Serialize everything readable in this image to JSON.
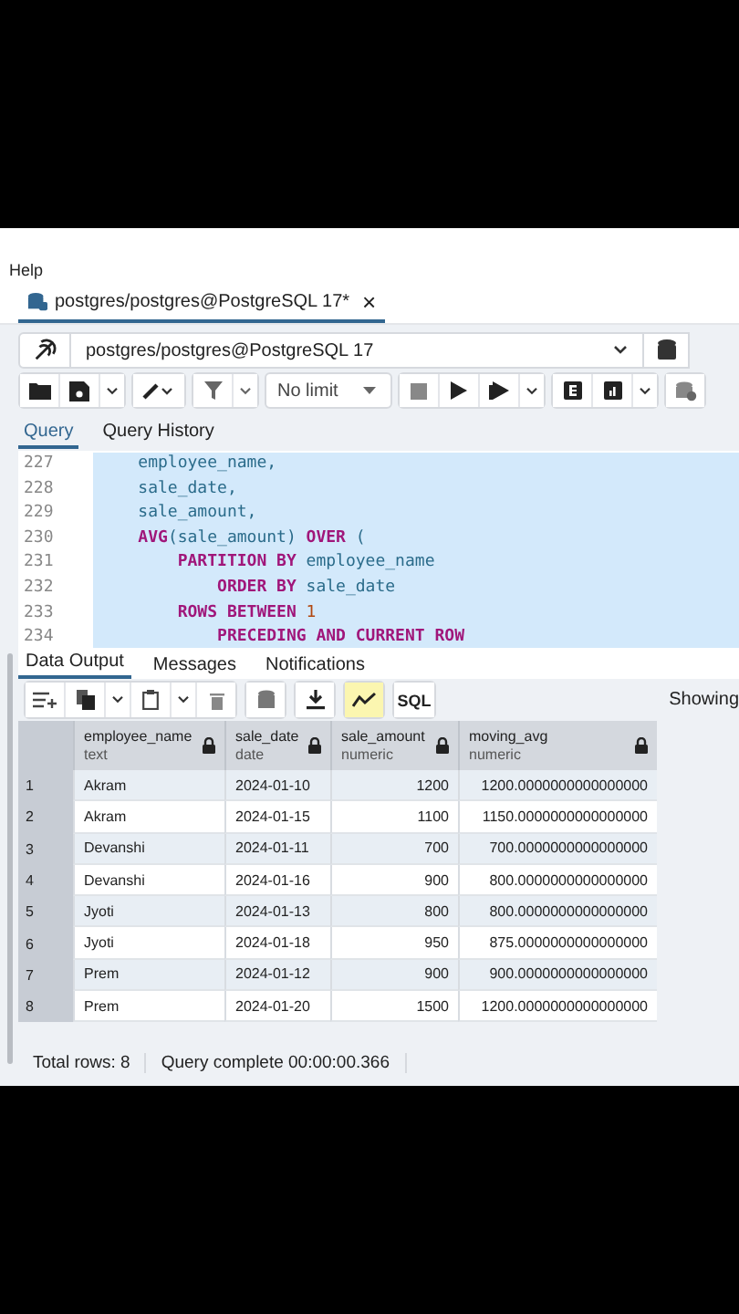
{
  "menu": {
    "item": "Help"
  },
  "query_tab": {
    "title": "postgres/postgres@PostgreSQL 17*",
    "close": "×"
  },
  "connection": {
    "value": "postgres/postgres@PostgreSQL 17"
  },
  "toolbar": {
    "limit": "No limit"
  },
  "editor_tabs": [
    {
      "label": "Query",
      "selected": true
    },
    {
      "label": "Query History",
      "selected": false
    }
  ],
  "code": [
    {
      "number": "227",
      "tokens": [
        {
          "kind": "plain",
          "text": "    employee_name,"
        }
      ]
    },
    {
      "number": "228",
      "tokens": [
        {
          "kind": "plain",
          "text": "    sale_date,"
        }
      ]
    },
    {
      "number": "229",
      "tokens": [
        {
          "kind": "plain",
          "text": "    sale_amount,"
        }
      ]
    },
    {
      "number": "230",
      "tokens": [
        {
          "kind": "keyword",
          "text": "    AVG"
        },
        {
          "kind": "plain",
          "text": "(sale_amount) "
        },
        {
          "kind": "keyword",
          "text": "OVER"
        },
        {
          "kind": "plain",
          "text": " ("
        }
      ]
    },
    {
      "number": "231",
      "tokens": [
        {
          "kind": "keyword",
          "text": "        PARTITION BY"
        },
        {
          "kind": "plain",
          "text": " employee_name"
        }
      ]
    },
    {
      "number": "232",
      "tokens": [
        {
          "kind": "keyword",
          "text": "            ORDER BY"
        },
        {
          "kind": "plain",
          "text": " sale_date"
        }
      ]
    },
    {
      "number": "233",
      "tokens": [
        {
          "kind": "keyword",
          "text": "        ROWS BETWEEN"
        },
        {
          "kind": "number",
          "text": " 1"
        }
      ]
    },
    {
      "number": "234",
      "tokens": [
        {
          "kind": "keyword",
          "text": "            PRECEDING AND CURRENT ROW"
        }
      ]
    }
  ],
  "output_tabs": [
    {
      "label": "Data Output",
      "selected": true
    },
    {
      "label": "Messages",
      "selected": false
    },
    {
      "label": "Notifications",
      "selected": false
    }
  ],
  "result_toolbar": {
    "sql_button": "SQL",
    "showing": "Showing"
  },
  "table": {
    "columns": [
      {
        "name": "employee_name",
        "type": "text",
        "kind": "text"
      },
      {
        "name": "sale_date",
        "type": "date",
        "kind": "text"
      },
      {
        "name": "sale_amount",
        "type": "numeric",
        "kind": "number"
      },
      {
        "name": "moving_avg",
        "type": "numeric",
        "kind": "number"
      }
    ],
    "rows": [
      {
        "number": "1",
        "cells": [
          "Akram",
          "2024-01-10",
          "1200",
          "1200.0000000000000000"
        ]
      },
      {
        "number": "2",
        "cells": [
          "Akram",
          "2024-01-15",
          "1100",
          "1150.0000000000000000"
        ]
      },
      {
        "number": "3",
        "cells": [
          "Devanshi",
          "2024-01-11",
          "700",
          "700.0000000000000000"
        ]
      },
      {
        "number": "4",
        "cells": [
          "Devanshi",
          "2024-01-16",
          "900",
          "800.0000000000000000"
        ]
      },
      {
        "number": "5",
        "cells": [
          "Jyoti",
          "2024-01-13",
          "800",
          "800.0000000000000000"
        ]
      },
      {
        "number": "6",
        "cells": [
          "Jyoti",
          "2024-01-18",
          "950",
          "875.0000000000000000"
        ]
      },
      {
        "number": "7",
        "cells": [
          "Prem",
          "2024-01-12",
          "900",
          "900.0000000000000000"
        ]
      },
      {
        "number": "8",
        "cells": [
          "Prem",
          "2024-01-20",
          "1500",
          "1200.0000000000000000"
        ]
      }
    ]
  },
  "status_bar": {
    "total": "Total rows: 8",
    "query": "Query complete 00:00:00.366"
  }
}
